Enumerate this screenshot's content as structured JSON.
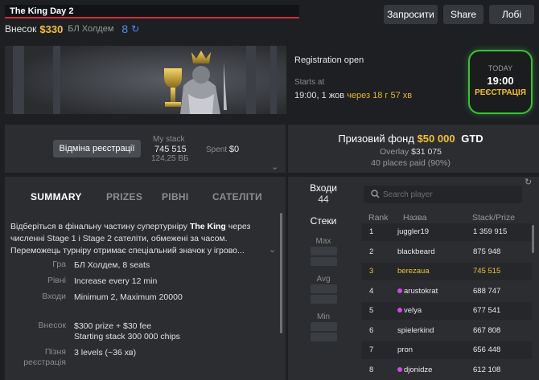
{
  "header": {
    "title": "The King Day 2",
    "buyin_label": "Внесок",
    "buyin_value": "$330",
    "game_type": "БЛ Холдем",
    "players_count": "8",
    "buttons": {
      "invite": "Запросити",
      "share": "Share",
      "lobby": "Лобі"
    }
  },
  "registration": {
    "status": "Registration open",
    "starts_label": "Starts at",
    "starts_value": "19:00, 1 жов",
    "countdown": "через 18 г 57 хв",
    "today_label": "TODAY",
    "today_time": "19:00",
    "today_status": "РЕЄСТРАЦІЯ"
  },
  "stack": {
    "unregister_button": "Відміна реєстрації",
    "my_stack_label": "My stack",
    "my_stack_value": "745 515",
    "my_stack_bb": "124,25 ВБ",
    "spent_label": "Spent",
    "spent_value": "$0"
  },
  "tabs": [
    "SUMMARY",
    "PRIZES",
    "РІВНІ",
    "САТЕЛІТИ"
  ],
  "summary": {
    "desc_1": "Відберіться в фінальну частину супертурніру ",
    "desc_bold": "The King",
    "desc_2": " через численні Stage 1 і Stage 2 сателіти, обмежені за часом. Переможець турніру отримає спеціальний значок у ігрово...",
    "rows": [
      {
        "label": "Гра",
        "value": "БЛ Холдем, 8 seats"
      },
      {
        "label": "Рівні",
        "value": "Increase every 12 min"
      },
      {
        "label": "Входи",
        "value": "Minimum 2, Maximum 20000"
      },
      {
        "label": "Внесок",
        "value": "$300 prize + $30 fee",
        "value2": "Starting stack 300 000 chips"
      },
      {
        "label": "Пізня реєстрація",
        "value": "3 levels (~36 хв)"
      }
    ]
  },
  "prize": {
    "label": "Призовий фонд",
    "amount": "$50 000",
    "gtd": "GTD",
    "overlay_label": "Overlay",
    "overlay_value": "$31 075",
    "places": "40 places paid (90%)"
  },
  "entries": {
    "label": "Входи",
    "value": "44",
    "stacks_label": "Стеки",
    "max_label": "Max",
    "avg_label": "Avg",
    "min_label": "Min"
  },
  "players": {
    "search_placeholder": "Search player",
    "columns": {
      "rank": "Rank",
      "name": "Назва",
      "stack": "Stack/Prize"
    },
    "rows": [
      {
        "rank": "1",
        "name": "juggler19",
        "stack": "1 359 915"
      },
      {
        "rank": "2",
        "name": "blackbeard",
        "stack": "875 948"
      },
      {
        "rank": "3",
        "name": "berezaua",
        "stack": "745 515"
      },
      {
        "rank": "4",
        "name": "arustokrat",
        "stack": "688 747"
      },
      {
        "rank": "5",
        "name": "velya",
        "stack": "677 541"
      },
      {
        "rank": "6",
        "name": "spielerkind",
        "stack": "667 808"
      },
      {
        "rank": "7",
        "name": "pron",
        "stack": "656 448"
      },
      {
        "rank": "8",
        "name": "djonidze",
        "stack": "612 108"
      }
    ]
  },
  "colors": {
    "accent": "#f2c230",
    "brand_red": "#c8303a",
    "today_green": "#3fbf3a",
    "link_blue": "#4f8cff"
  }
}
